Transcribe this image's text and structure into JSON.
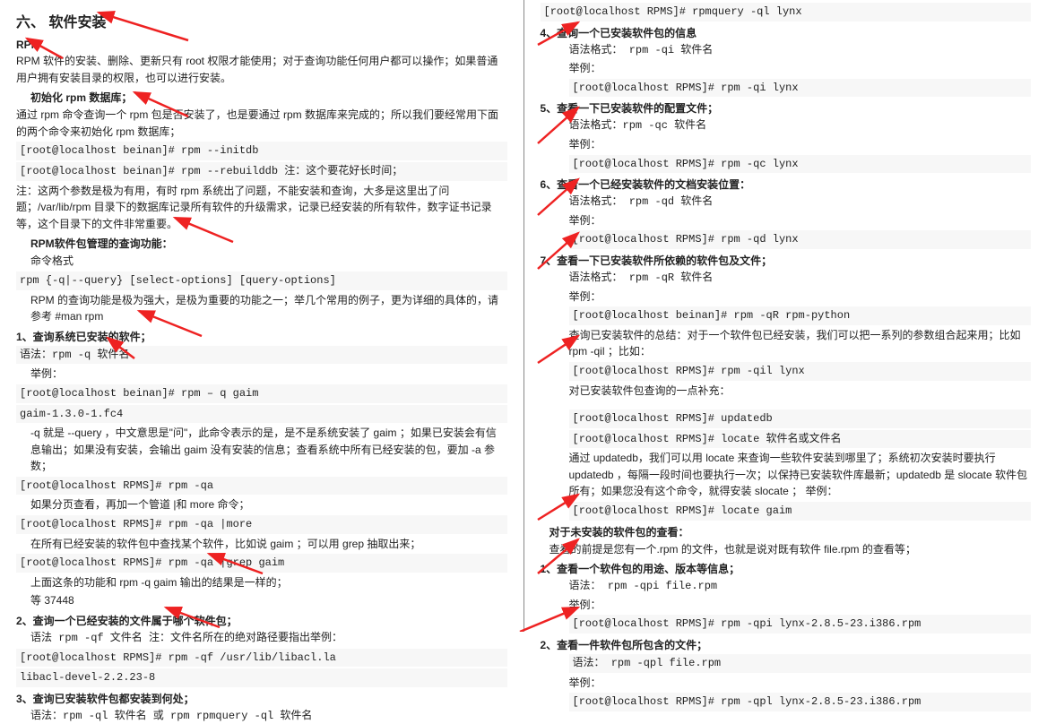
{
  "left": {
    "title": "六、 软件安装",
    "rpm_header": "RPM",
    "intro": "RPM 软件的安装、删除、更新只有 root 权限才能使用；对于查询功能任何用户都可以操作；如果普通用户拥有安装目录的权限，也可以进行安装。",
    "init_heading": "初始化 rpm 数据库；",
    "init_p": "通过 rpm 命令查询一个 rpm 包是否安装了，也是要通过 rpm 数据库来完成的；所以我们要经常用下面的两个命令来初始化 rpm 数据库；",
    "init_cmd1": "[root@localhost beinan]# rpm --initdb",
    "init_cmd2": "[root@localhost beinan]# rpm --rebuilddb    注：这个要花好长时间；",
    "init_note": "注：这两个参数是极为有用，有时 rpm 系统出了问题，不能安装和查询，大多是这里出了问题；/var/lib/rpm 目录下的数据库记录所有软件的升级需求，记录已经安装的所有软件，数字证书记录等，这个目录下的文件非常重要。",
    "query_heading": "RPM软件包管理的查询功能：",
    "cmd_format_label": "命令格式",
    "cmd_format": "rpm {-q|--query} [select-options] [query-options]",
    "query_note": "RPM 的查询功能是极为强大，是极为重要的功能之一；举几个常用的例子，更为详细的具体的，请参考 #man rpm",
    "sec1_heading": "1、查询系统已安装的软件；",
    "sec1_syntax": "语法：rpm -q 软件名",
    "sec1_example_label": "举例：",
    "sec1_cmd1": "[root@localhost beinan]# rpm – q gaim",
    "sec1_cmd2": "gaim-1.3.0-1.fc4",
    "sec1_note": "-q 就是 --query ，中文意思是\"问\"，此命令表示的是，是不是系统安装了 gaim ；如果已安装会有信息输出；如果没有安装，会输出 gaim 没有安装的信息；查看系统中所有已经安装的包，要加 -a 参数；",
    "sec1_cmd3": "[root@localhost RPMS]# rpm -qa",
    "sec1_note2": "如果分页查看，再加一个管道 |和 more 命令；",
    "sec1_cmd4": "[root@localhost RPMS]# rpm -qa |more",
    "sec1_note3": "在所有已经安装的软件包中查找某个软件，比如说 gaim ；可以用 grep 抽取出来；",
    "sec1_cmd5": "[root@localhost RPMS]# rpm -qa |grep gaim",
    "sec1_note4": "上面这条的功能和 rpm -q gaim 输出的结果是一样的；",
    "sec1_note5": "等 37448",
    "sec2_heading": "2、查询一个已经安装的文件属于哪个软件包；",
    "sec2_syntax": "语法 rpm -qf 文件名    注：文件名所在的绝对路径要指出举例：",
    "sec2_cmd1": "[root@localhost RPMS]# rpm -qf /usr/lib/libacl.la",
    "sec2_cmd2": "libacl-devel-2.2.23-8",
    "sec3_heading": "3、查询已安装软件包都安装到何处；",
    "sec3_syntax": "语法：rpm -ql   软件名  或 rpm rpmquery -ql   软件名"
  },
  "right": {
    "line0": "[root@localhost RPMS]# rpmquery -ql   lynx",
    "sec4_heading": "4、查询一个已安装软件包的信息",
    "sec4_syntax": "语法格式： rpm -qi 软件名",
    "example_label": "举例：",
    "sec4_cmd": "[root@localhost RPMS]# rpm -qi lynx",
    "sec5_heading": "5、查看一下已安装软件的配置文件；",
    "sec5_syntax": "语法格式：rpm -qc 软件名",
    "sec5_cmd": "[root@localhost RPMS]# rpm -qc lynx",
    "sec6_heading": "6、查看一个已经安装软件的文档安装位置：",
    "sec6_syntax": "语法格式： rpm -qd 软件名",
    "sec6_cmd": "[root@localhost RPMS]# rpm -qd lynx",
    "sec7_heading": "7、查看一下已安装软件所依赖的软件包及文件；",
    "sec7_syntax": "语法格式： rpm -qR 软件名",
    "sec7_cmd": "[root@localhost beinan]# rpm -qR  rpm-python",
    "sec7_note": "查询已安装软件的总结：对于一个软件包已经安装，我们可以把一系列的参数组合起来用；比如 rpm -qil ；比如：",
    "sec7_cmd2": "[root@localhost RPMS]# rpm -qil lynx",
    "sec7_note2": "对已安装软件包查询的一点补充：",
    "sec7_cmd3": "[root@localhost RPMS]# updatedb",
    "sec7_cmd4": "[root@localhost RPMS]#   locate  软件名或文件名",
    "sec7_note3": "通过 updatedb，我们可以用 locate 来查询一些软件安装到哪里了；系统初次安装时要执行 updatedb ，每隔一段时间也要执行一次；以保持已安装软件库最新；updatedb 是 slocate 软件包所有；如果您没有这个命令，就得安装 slocate ； 举例：",
    "sec7_cmd5": "[root@localhost RPMS]#  locate gaim",
    "uninst_heading": "对于未安装的软件包的查看：",
    "uninst_note": "查看的前提是您有一个.rpm 的文件，也就是说对既有软件 file.rpm 的查看等；",
    "u1_heading": "1、查看一个软件包的用途、版本等信息；",
    "u1_syntax": "语法： rpm -qpi file.rpm",
    "u1_cmd": "[root@localhost RPMS]# rpm -qpi lynx-2.8.5-23.i386.rpm",
    "u2_heading": "2、查看一件软件包所包含的文件；",
    "u2_syntax": "语法： rpm -qpl   file.rpm",
    "u2_cmd": "[root@localhost RPMS]# rpm -qpl  lynx-2.8.5-23.i386.rpm"
  }
}
